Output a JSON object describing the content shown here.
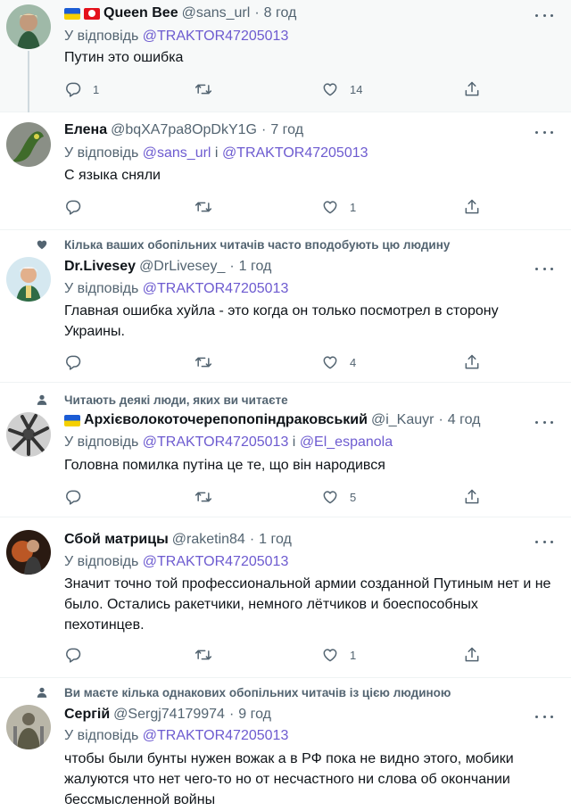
{
  "reply_prefix": "У відповідь",
  "tweets": [
    {
      "name": "Queen Bee",
      "handle": "@sans_url",
      "time": "8 год",
      "reply_to": [
        "@TRAKTOR47205013"
      ],
      "text": "Путин это ошибка",
      "replies": "1",
      "retweets": "",
      "likes": "14"
    },
    {
      "name": "Елена",
      "handle": "@bqXA7pa8OpDkY1G",
      "time": "7 год",
      "reply_to": [
        "@sans_url",
        "@TRAKTOR47205013"
      ],
      "joiner": "і",
      "text": "С языка сняли",
      "replies": "",
      "retweets": "",
      "likes": "1"
    },
    {
      "context": "Кілька ваших обопільних читачів часто вподобують цю людину",
      "name": "Dr.Livesey",
      "handle": "@DrLivesey_",
      "time": "1 год",
      "reply_to": [
        "@TRAKTOR47205013"
      ],
      "text": "Главная ошибка хуйла - это когда он только посмотрел в сторону Украины.",
      "replies": "",
      "retweets": "",
      "likes": "4"
    },
    {
      "context": "Читають деякі люди, яких ви читаєте",
      "name": "Архієволокоточерепопопіндраковський",
      "handle": "@i_Kauyr",
      "time": "4 год",
      "reply_to": [
        "@TRAKTOR47205013",
        "@El_espanola"
      ],
      "joiner": "і",
      "text": "Головна помилка путіна це те, що він народився",
      "replies": "",
      "retweets": "",
      "likes": "5"
    },
    {
      "name": "Сбой матрицы",
      "handle": "@raketin84",
      "time": "1 год",
      "reply_to": [
        "@TRAKTOR47205013"
      ],
      "text": "Значит точно той профессиональной армии созданной Путиным нет и не было. Остались ракетчики, немного лётчиков и боеспособных пехотинцев.",
      "replies": "",
      "retweets": "",
      "likes": "1"
    },
    {
      "context": "Ви маєте кілька однакових обопільних читачів із цією людиною",
      "name": "Сергій",
      "handle": "@Sergj74179974",
      "time": "9 год",
      "reply_to": [
        "@TRAKTOR47205013"
      ],
      "text": "чтобы были бунты нужен вожак а в РФ пока не видно этого, мобики жалуются что нет чего-то но от несчастного ни слова об окончании бессмысленной войны",
      "replies": "",
      "retweets": "",
      "likes": ""
    }
  ]
}
